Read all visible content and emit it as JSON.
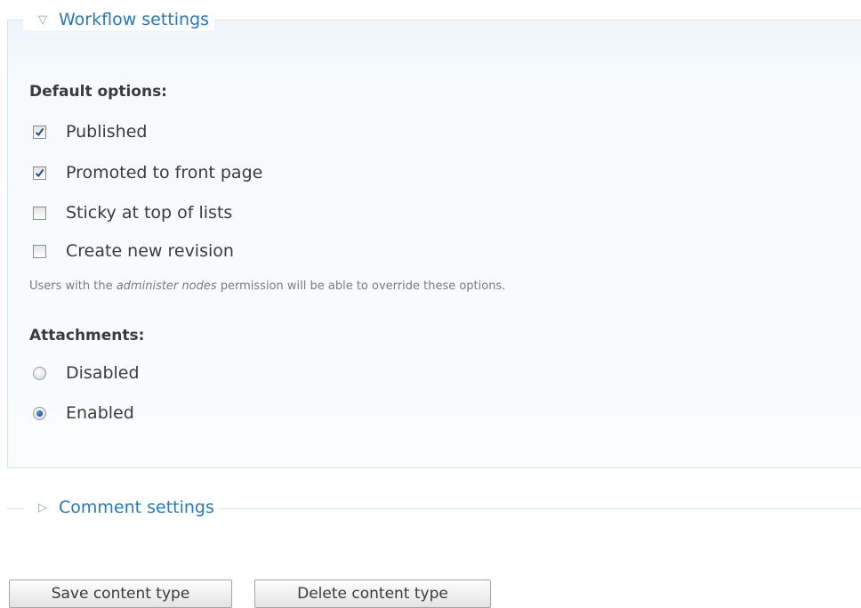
{
  "workflow": {
    "legend": "Workflow settings",
    "legend_icon": "triangle-down-icon",
    "default_options_title": "Default options:",
    "options": [
      {
        "label": "Published",
        "checked": true
      },
      {
        "label": "Promoted to front page",
        "checked": true
      },
      {
        "label": "Sticky at top of lists",
        "checked": false
      },
      {
        "label": "Create new revision",
        "checked": false
      }
    ],
    "description": {
      "prefix": "Users with the ",
      "emphasis": "administer nodes",
      "suffix": " permission will be able to override these options."
    },
    "attachments_title": "Attachments:",
    "attachments": [
      {
        "label": "Disabled",
        "selected": false
      },
      {
        "label": "Enabled",
        "selected": true
      }
    ]
  },
  "comments": {
    "legend": "Comment settings",
    "legend_icon": "triangle-right-icon"
  },
  "buttons": {
    "save": "Save content type",
    "delete": "Delete content type"
  },
  "colors": {
    "link": "#2a78b8",
    "fieldset_border": "#d3e7f4",
    "fieldset_bg": "#f6fafd"
  }
}
